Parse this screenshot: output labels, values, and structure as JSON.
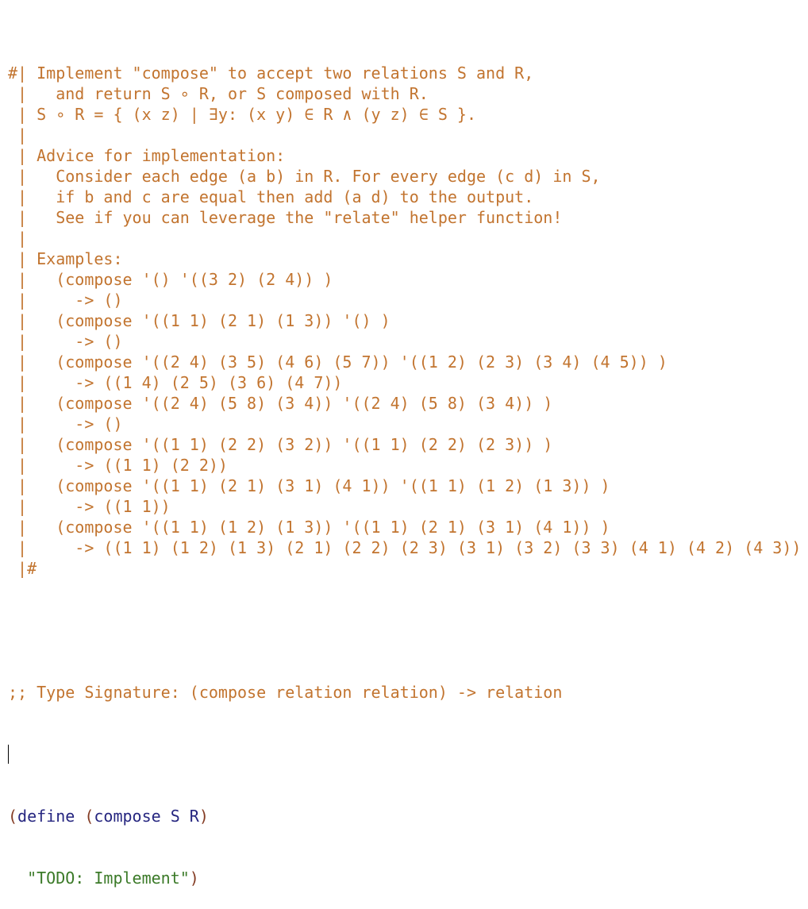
{
  "editor": {
    "block_comment": [
      "#| Implement \"compose\" to accept two relations S and R,",
      " |   and return S ∘ R, or S composed with R.",
      " | S ∘ R = { (x z) | ∃y: (x y) ∈ R ∧ (y z) ∈ S }.",
      " |",
      " | Advice for implementation:",
      " |   Consider each edge (a b) in R. For every edge (c d) in S,",
      " |   if b and c are equal then add (a d) to the output.",
      " |   See if you can leverage the \"relate\" helper function!",
      " |",
      " | Examples:",
      " |   (compose '() '((3 2) (2 4)) )",
      " |     -> ()",
      " |   (compose '((1 1) (2 1) (1 3)) '() )",
      " |     -> ()",
      " |   (compose '((2 4) (3 5) (4 6) (5 7)) '((1 2) (2 3) (3 4) (4 5)) )",
      " |     -> ((1 4) (2 5) (3 6) (4 7))",
      " |   (compose '((2 4) (5 8) (3 4)) '((2 4) (5 8) (3 4)) )",
      " |     -> ()",
      " |   (compose '((1 1) (2 2) (3 2)) '((1 1) (2 2) (2 3)) )",
      " |     -> ((1 1) (2 2))",
      " |   (compose '((1 1) (2 1) (3 1) (4 1)) '((1 1) (1 2) (1 3)) )",
      " |     -> ((1 1))",
      " |   (compose '((1 1) (1 2) (1 3)) '((1 1) (2 1) (3 1) (4 1)) )",
      " |     -> ((1 1) (1 2) (1 3) (2 1) (2 2) (2 3) (3 1) (3 2) (3 3) (4 1) (4 2) (4 3))",
      " |#"
    ],
    "type_signature": ";; Type Signature: (compose relation relation) -> relation",
    "define": {
      "open_paren": "(",
      "keyword": "define",
      "space": " ",
      "inner_open_paren": "(",
      "signature": "compose S R",
      "inner_close_paren": ")",
      "indent": "  ",
      "body_string": "\"TODO: Implement\"",
      "close_paren": ")"
    }
  }
}
